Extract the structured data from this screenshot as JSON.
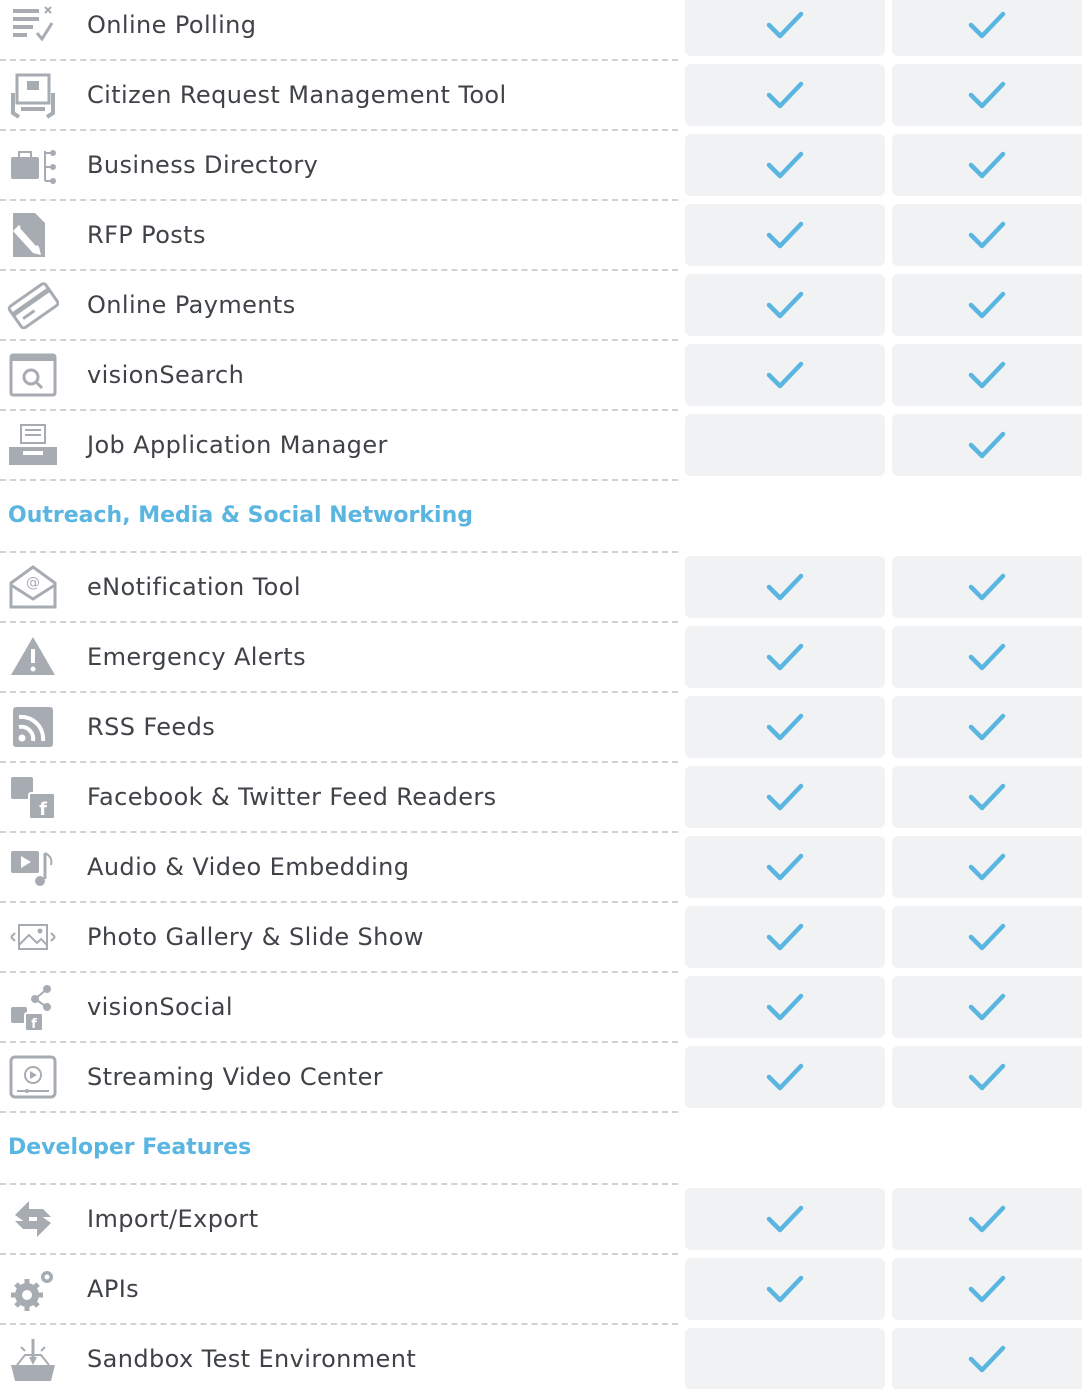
{
  "colors": {
    "check": "#5ab6e1",
    "cell_bg": "#f1f2f4",
    "icon": "#a7acb2",
    "section": "#5ab6e1",
    "text": "#3f4247"
  },
  "groups": [
    {
      "title": "",
      "rows": [
        {
          "label": "Online Polling",
          "icon": "poll-icon",
          "col1": true,
          "col2": true
        },
        {
          "label": "Citizen Request Management Tool",
          "icon": "request-board-icon",
          "col1": true,
          "col2": true
        },
        {
          "label": "Business Directory",
          "icon": "briefcase-directory-icon",
          "col1": true,
          "col2": true
        },
        {
          "label": "RFP Posts",
          "icon": "document-pencil-icon",
          "col1": true,
          "col2": true
        },
        {
          "label": "Online Payments",
          "icon": "credit-card-icon",
          "col1": true,
          "col2": true
        },
        {
          "label": "visionSearch",
          "icon": "search-window-icon",
          "col1": true,
          "col2": true
        },
        {
          "label": "Job Application Manager",
          "icon": "inbox-tray-icon",
          "col1": false,
          "col2": true
        }
      ]
    },
    {
      "title": "Outreach, Media & Social Networking",
      "rows": [
        {
          "label": "eNotification Tool",
          "icon": "email-icon",
          "col1": true,
          "col2": true
        },
        {
          "label": "Emergency Alerts",
          "icon": "warning-icon",
          "col1": true,
          "col2": true
        },
        {
          "label": "RSS Feeds",
          "icon": "rss-icon",
          "col1": true,
          "col2": true
        },
        {
          "label": "Facebook & Twitter Feed Readers",
          "icon": "social-feeds-icon",
          "col1": true,
          "col2": true
        },
        {
          "label": "Audio & Video Embedding",
          "icon": "media-icon",
          "col1": true,
          "col2": true
        },
        {
          "label": "Photo Gallery & Slide Show",
          "icon": "gallery-icon",
          "col1": true,
          "col2": true
        },
        {
          "label": "visionSocial",
          "icon": "share-icon",
          "col1": true,
          "col2": true
        },
        {
          "label": "Streaming Video Center",
          "icon": "video-player-icon",
          "col1": true,
          "col2": true
        }
      ]
    },
    {
      "title": "Developer Features",
      "rows": [
        {
          "label": "Import/Export",
          "icon": "sync-arrows-icon",
          "col1": true,
          "col2": true
        },
        {
          "label": "APIs",
          "icon": "gears-icon",
          "col1": true,
          "col2": true
        },
        {
          "label": "Sandbox Test Environment",
          "icon": "sandbox-icon",
          "col1": false,
          "col2": true
        }
      ]
    }
  ]
}
